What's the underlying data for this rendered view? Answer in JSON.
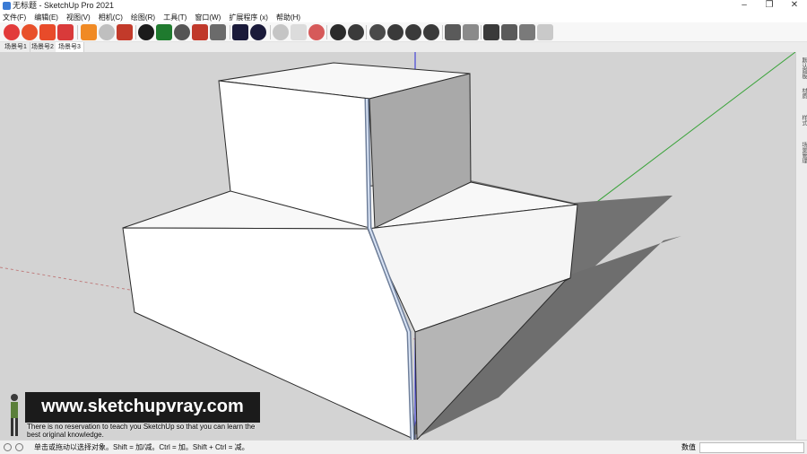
{
  "window": {
    "title": "无标题 - SketchUp Pro 2021",
    "minimize": "–",
    "restore": "❐",
    "close": "✕"
  },
  "menu": [
    "文件(F)",
    "编辑(E)",
    "视图(V)",
    "相机(C)",
    "绘图(R)",
    "工具(T)",
    "窗口(W)",
    "扩展程序 (x)",
    "帮助(H)"
  ],
  "toolbar": {
    "icons": [
      "sketchup-logo-icon",
      "settings-gear-icon",
      "open-folder-icon",
      "camera-icon",
      "sync-icon",
      "refresh-icon",
      "layers-icon",
      "add-icon",
      "tree-icon",
      "checker-icon",
      "cloud-icon",
      "extension-icon",
      "mail-icon",
      "info-icon",
      "bars-icon",
      "wand-icon",
      "bird-icon",
      "vray-icon",
      "material-icon",
      "teapot-icon",
      "sphere-icon",
      "render-icon",
      "interactive-icon",
      "frame-icon",
      "window-icon",
      "window2-icon",
      "window3-icon",
      "lock-icon"
    ]
  },
  "tabs": [
    "场景号1",
    "场景号2",
    "场景号3"
  ],
  "active_tab": 2,
  "right_panel": [
    "默认面板",
    "材质",
    "样式",
    "场景管理"
  ],
  "watermark": {
    "url": "www.sketchupvray.com",
    "caption": "There is no reservation to teach you SketchUp so that you can learn the best original knowledge."
  },
  "status": {
    "hint": "单击或拖动以选择对象。Shift = 加/减。Ctrl = 加。Shift + Ctrl = 减。",
    "measurements_label": "数值",
    "measurements_value": ""
  },
  "colors": {
    "sky": "#d3d3d3",
    "ground": "#d3d3d3",
    "axis_green": "#3aa33a",
    "axis_blue": "#2a2ad8",
    "axis_red": "#c06a6a",
    "shadow": "#727272"
  }
}
